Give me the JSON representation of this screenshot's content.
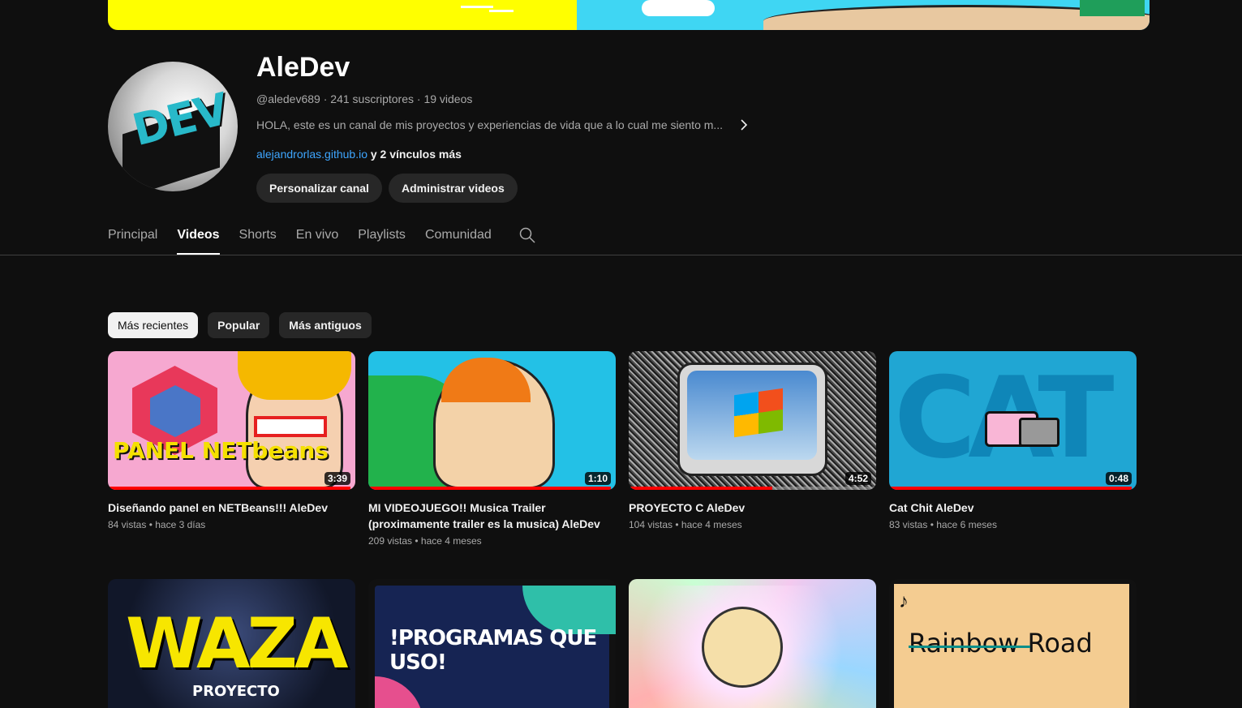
{
  "channel": {
    "name": "AleDev",
    "handle": "@aledev689",
    "subscribers": "241 suscriptores",
    "videos_count": "19 videos",
    "description": "HOLA, este es un canal de mis proyectos y experiencias de vida que a lo cual me siento m...",
    "link": "alejandrorlas.github.io",
    "more_links": "y 2 vínculos más",
    "avatar_text": "DEV"
  },
  "buttons": {
    "customize": "Personalizar canal",
    "manage": "Administrar videos"
  },
  "tabs": [
    {
      "label": "Principal"
    },
    {
      "label": "Videos"
    },
    {
      "label": "Shorts"
    },
    {
      "label": "En vivo"
    },
    {
      "label": "Playlists"
    },
    {
      "label": "Comunidad"
    }
  ],
  "active_tab": "Videos",
  "chips": [
    {
      "label": "Más recientes"
    },
    {
      "label": "Popular"
    },
    {
      "label": "Más antiguos"
    }
  ],
  "active_chip": "Más recientes",
  "videos": [
    {
      "title": "Diseñando panel en NETBeans!!! AleDev",
      "views": "84 vistas",
      "date": "hace 3 días",
      "duration": "3:39",
      "watched_fraction": 0.98,
      "thumb_text": "PANEL NETbeans"
    },
    {
      "title": "MI VIDEOJUEGO!! Musica Trailer (proximamente trailer es la musica) AleDev",
      "views": "209 vistas",
      "date": "hace 4 meses",
      "duration": "1:10",
      "watched_fraction": 0.98
    },
    {
      "title": "PROYECTO C AleDev",
      "views": "104 vistas",
      "date": "hace 4 meses",
      "duration": "4:52",
      "watched_fraction": 0.58
    },
    {
      "title": "Cat Chit AleDev",
      "views": "83 vistas",
      "date": "hace 6 meses",
      "duration": "0:48",
      "watched_fraction": 0.98,
      "thumb_text": "CAT CHIT"
    },
    {
      "thumb_text": "WAZA",
      "thumb_sub": "PROYECTO"
    },
    {
      "thumb_text": "!PROGRAMAS QUE USO!"
    },
    {},
    {
      "thumb_text": "Rainbow Road"
    }
  ],
  "colors": {
    "background": "#0f0f0f",
    "link": "#3ea6ff",
    "progress": "#ff0000"
  },
  "icons": [
    "chevron-right-icon",
    "search-icon"
  ]
}
